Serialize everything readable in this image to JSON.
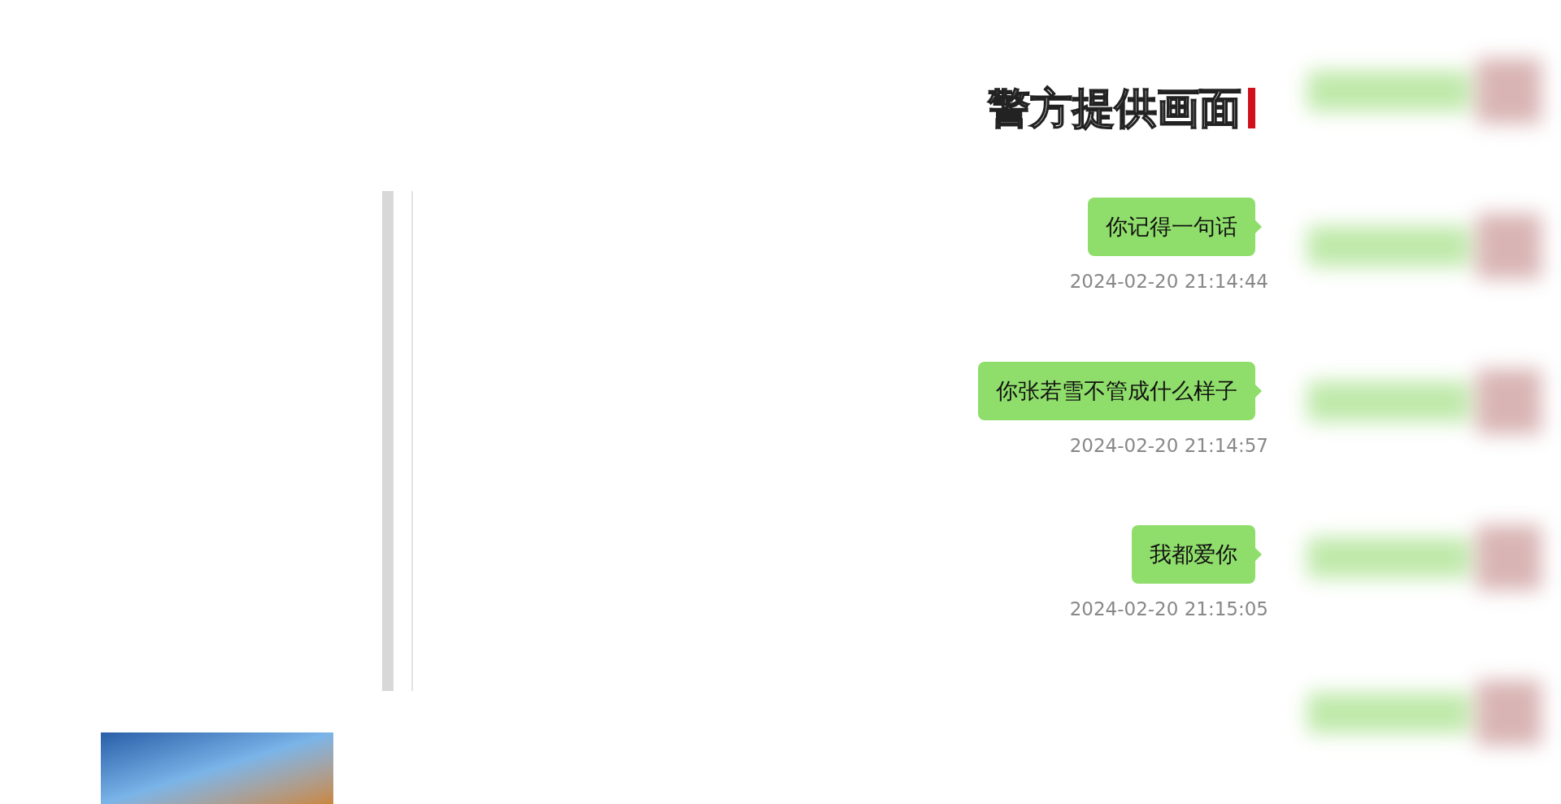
{
  "caption": "警方提供画面",
  "messages": [
    {
      "text": "你记得一句话",
      "time": "2024-02-20 21:14:44"
    },
    {
      "text": "你张若雪不管成什么样子",
      "time": "2024-02-20 21:14:57"
    },
    {
      "text": "我都爱你",
      "time": "2024-02-20 21:15:05"
    }
  ]
}
